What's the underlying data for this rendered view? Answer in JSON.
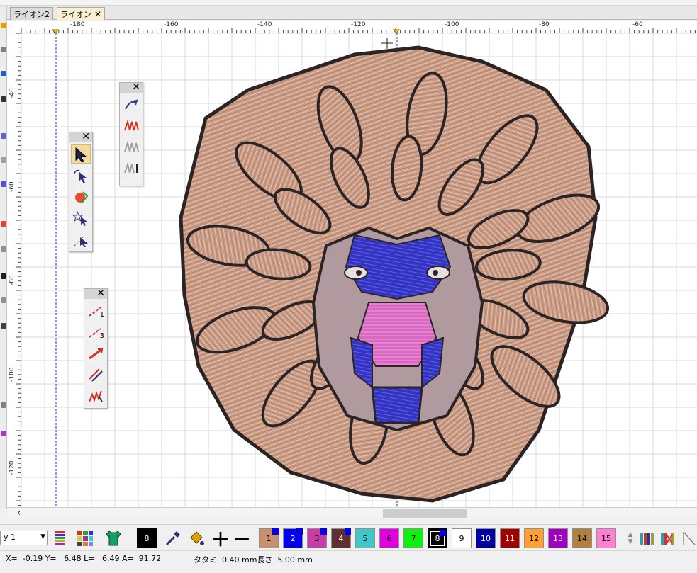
{
  "tabs": [
    {
      "label": "ライオン2",
      "active": false
    },
    {
      "label": "ライオン",
      "active": true
    }
  ],
  "ruler": {
    "h_labels": [
      "-180",
      "-160",
      "-140",
      "-120",
      "-100",
      "-80",
      "-60"
    ],
    "v_labels": [
      "-40",
      "-60",
      "-80",
      "-100",
      "-120"
    ]
  },
  "palettes": {
    "stitch_tools": {
      "tools": [
        "pen-draw-icon",
        "zigzag-stitch-icon",
        "zigzag-gray-icon",
        "zigzag-gray-arrow-icon"
      ]
    },
    "select_tools": {
      "tools": [
        "select-arrow-icon",
        "reshape-arrow-icon",
        "fill-edit-icon",
        "star-select-icon",
        "dotted-select-icon"
      ]
    },
    "line_tools": {
      "tools": [
        {
          "icon": "line-1-icon",
          "num": "1"
        },
        {
          "icon": "line-3-icon",
          "num": "3"
        },
        {
          "icon": "arrow-line-icon",
          "num": ""
        },
        {
          "icon": "double-arrow-line-icon",
          "num": ""
        },
        {
          "icon": "zigzag-arrow-icon",
          "num": ""
        }
      ]
    }
  },
  "threadbar": {
    "combo_value": "y 1",
    "current_color_num": "8",
    "threads": [
      {
        "num": "1",
        "color": "#c8906c",
        "has_marker": true
      },
      {
        "num": "2",
        "color": "#0000ee",
        "has_marker": true,
        "text_color": "#ffffff"
      },
      {
        "num": "3",
        "color": "#c83ca8",
        "has_marker": true
      },
      {
        "num": "4",
        "color": "#603030",
        "has_marker": true,
        "text_color": "#ffffff"
      },
      {
        "num": "5",
        "color": "#40c8c8",
        "has_marker": false
      },
      {
        "num": "6",
        "color": "#e000e0",
        "has_marker": false
      },
      {
        "num": "7",
        "color": "#10f010",
        "has_marker": false
      },
      {
        "num": "8",
        "color": "#000000",
        "has_marker": true,
        "text_color": "#ffffff",
        "selected": true
      },
      {
        "num": "9",
        "color": "#ffffff",
        "has_marker": false
      },
      {
        "num": "10",
        "color": "#0000a0",
        "has_marker": false,
        "text_color": "#ffffff"
      },
      {
        "num": "11",
        "color": "#a00000",
        "has_marker": false,
        "text_color": "#ffffff"
      },
      {
        "num": "12",
        "color": "#ffa030",
        "has_marker": false
      },
      {
        "num": "13",
        "color": "#a000c0",
        "has_marker": false,
        "text_color": "#ffffff"
      },
      {
        "num": "14",
        "color": "#b08040",
        "has_marker": false
      },
      {
        "num": "15",
        "color": "#ff80d0",
        "has_marker": false
      }
    ]
  },
  "status": {
    "coords": "X=  -0.19 Y=   6.48 L=   6.49 A=  91.72",
    "stitch_info": "タタミ  0.40 mm長さ  5.00 mm"
  },
  "colors": {
    "mane": "#c89a84",
    "mane_light": "#e6b8a4",
    "outline": "#2c2424",
    "face_blue": "#3030c0",
    "face_pink": "#e070c8",
    "face_mauve": "#b098a0"
  }
}
